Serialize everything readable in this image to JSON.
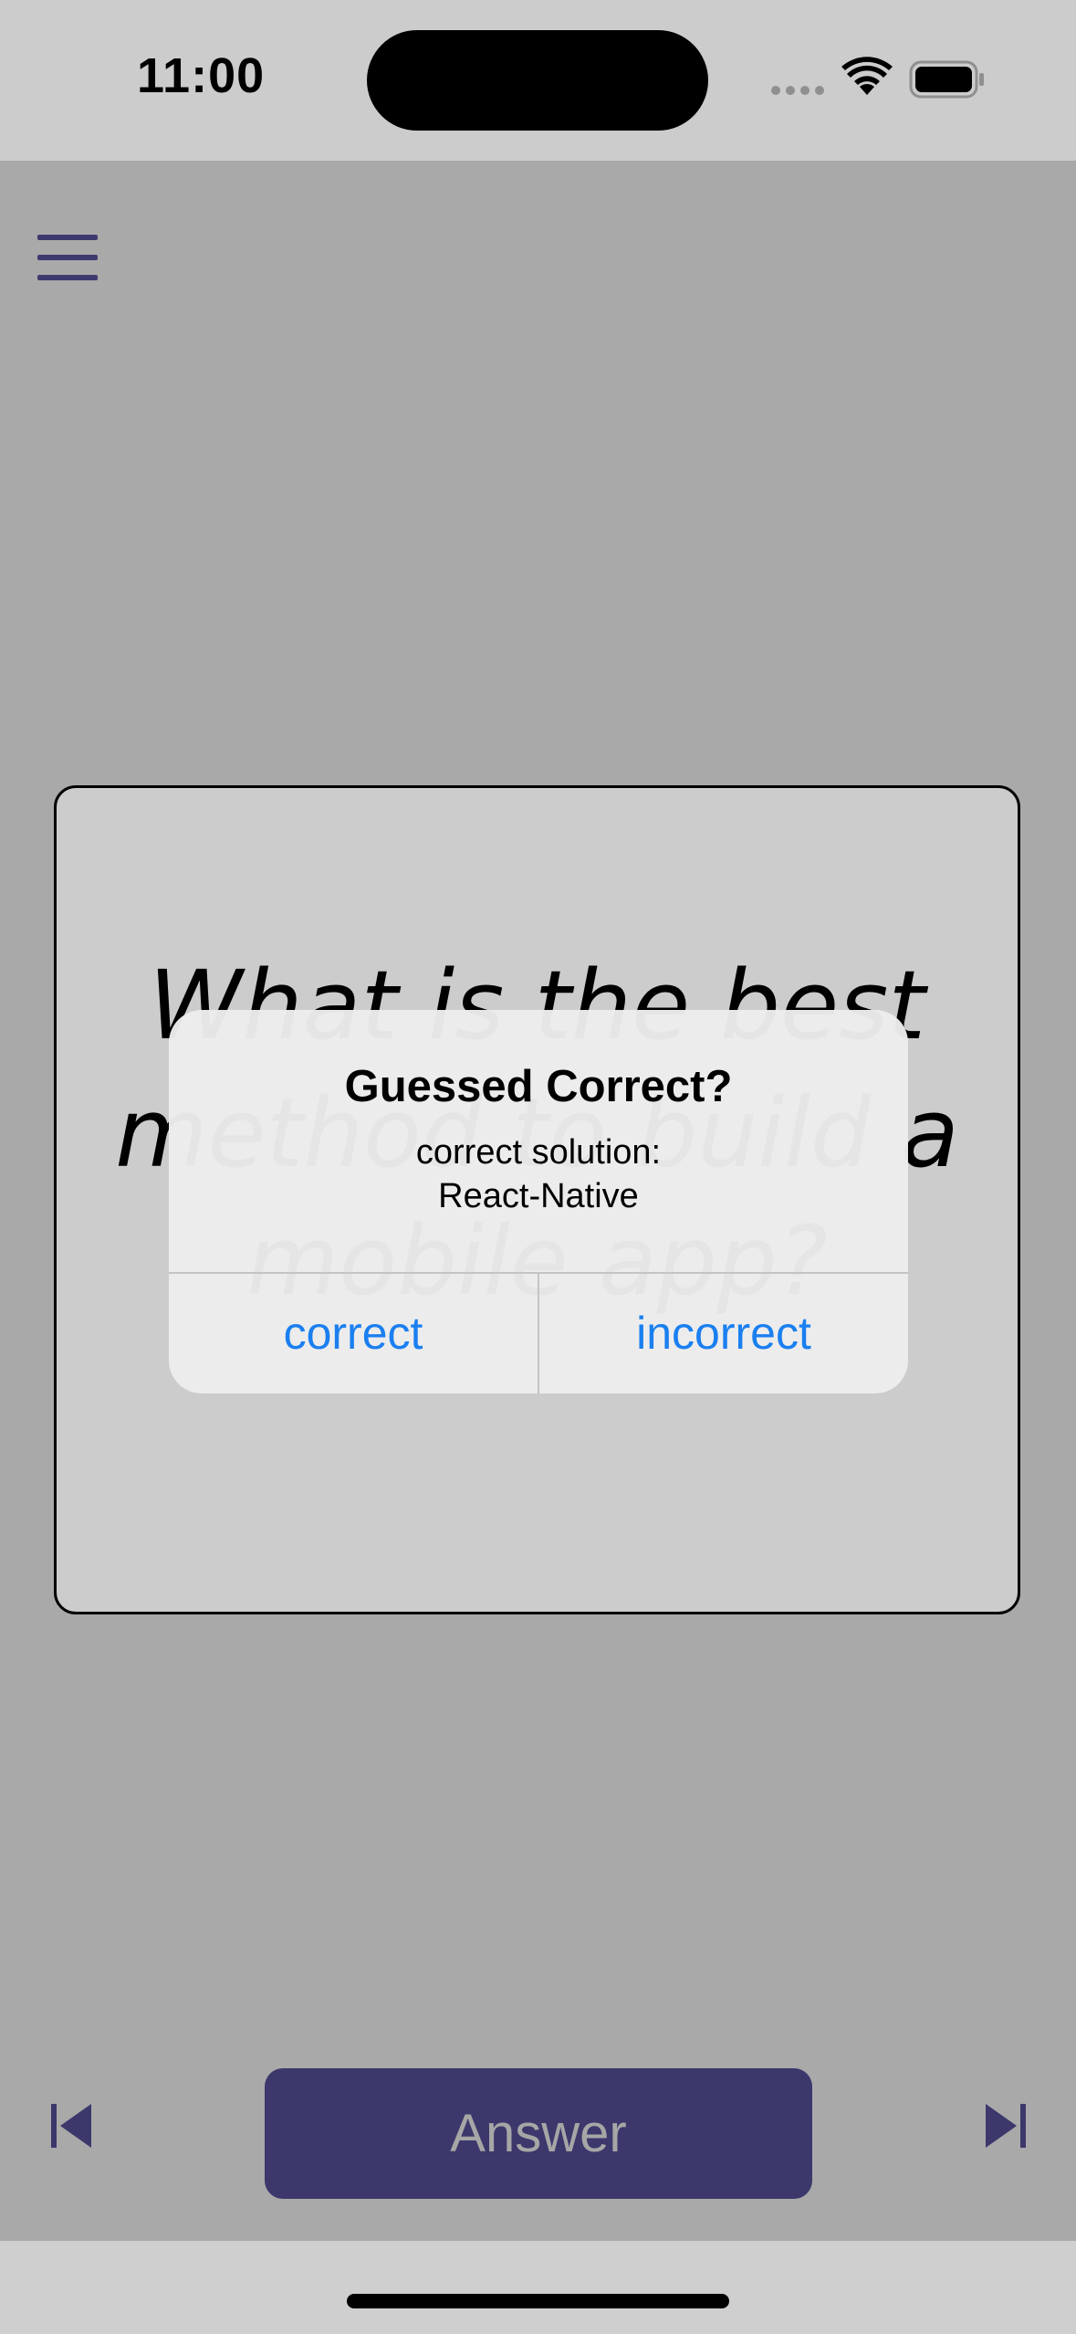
{
  "status_bar": {
    "time": "11:00"
  },
  "header": {
    "menu_icon": "hamburger-menu-icon"
  },
  "card": {
    "question": "What is the best method to build a mobile app?"
  },
  "alert": {
    "title": "Guessed Correct?",
    "message_line1": "correct solution:",
    "message_line2": "React-Native",
    "buttons": {
      "correct": "correct",
      "incorrect": "incorrect"
    }
  },
  "footer": {
    "answer_label": "Answer",
    "prev_icon": "skip-previous-icon",
    "next_icon": "skip-next-icon"
  },
  "colors": {
    "accent": "#3c386c",
    "alert_button": "#1a7ff0",
    "overlay_bg": "#a9a9a9"
  }
}
